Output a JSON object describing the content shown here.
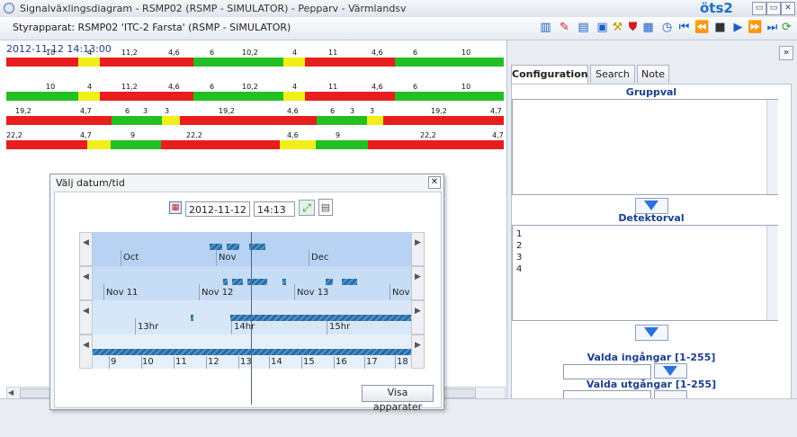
{
  "window": {
    "title": "Signalväxlingsdiagram - RSMP02 (RSMP - SIMULATOR) - Pepparv - Värmlandsv",
    "logo": "öts2",
    "minimize_label": "▭",
    "maximize_label": "▭",
    "close_label": "✕"
  },
  "toolbar": {
    "controller_label": "Styrapparat: RSMP02 'ITC-2 Farsta' (RSMP - SIMULATOR)",
    "icons": [
      "chart-icon",
      "pdf-icon",
      "export-icon",
      "monitor-icon",
      "tools-icon",
      "alarm-icon",
      "grid-icon",
      "clock-icon",
      "skip-start-icon",
      "rewind-icon",
      "stop-icon",
      "play-icon",
      "fast-forward-icon",
      "skip-end-icon",
      "refresh-icon"
    ]
  },
  "diagram": {
    "timestamp": "2012-11-12 14:13:00",
    "rows": [
      {
        "color": "mixed",
        "labels": [
          "10",
          "4",
          "11,2",
          "4,6",
          "6",
          "10,2",
          "4",
          "11",
          "4,6",
          "6",
          "10"
        ]
      },
      {
        "color": "mixed",
        "labels": [
          "10",
          "4",
          "11,2",
          "4,6",
          "6",
          "10,2",
          "4",
          "11",
          "4,6",
          "6",
          "10"
        ]
      },
      {
        "color": "mixed",
        "labels": [
          "19,2",
          "4,7",
          "6",
          "3",
          "3",
          "19,2",
          "4,6",
          "6",
          "3",
          "3",
          "19,2",
          "4,7"
        ]
      },
      {
        "color": "mixed",
        "labels": [
          "22,2",
          "4,7",
          "9",
          "22,2",
          "4,6",
          "9",
          "22,2",
          "4,7"
        ]
      }
    ]
  },
  "right_panel": {
    "collapse_label": "»",
    "tabs": [
      "Configuration",
      "Search",
      "Note"
    ],
    "active_tab": "Configuration",
    "gruppval_title": "Gruppval",
    "detektorval_title": "Detektorval",
    "detektor_items": [
      "1",
      "2",
      "3",
      "4"
    ],
    "valda_ingangar_title": "Valda ingångar [1-255]",
    "valda_utgangar_title": "Valda utgångar [1-255]",
    "valda_ingangar_value": "",
    "valda_utgangar_value": ""
  },
  "dialog": {
    "title": "Välj datum/tid",
    "close_label": "✕",
    "date_value": "2012-11-12",
    "time_value": "14:13",
    "button_label": "Visa apparater",
    "band_month": [
      "Oct",
      "Nov",
      "Dec"
    ],
    "band_day": [
      "Nov 11",
      "Nov 12",
      "Nov 13",
      "Nov"
    ],
    "band_hour": [
      "13hr",
      "14hr",
      "15hr"
    ],
    "band_minute": [
      "9",
      "10",
      "11",
      "12",
      "13",
      "14",
      "15",
      "16",
      "17",
      "18"
    ]
  }
}
